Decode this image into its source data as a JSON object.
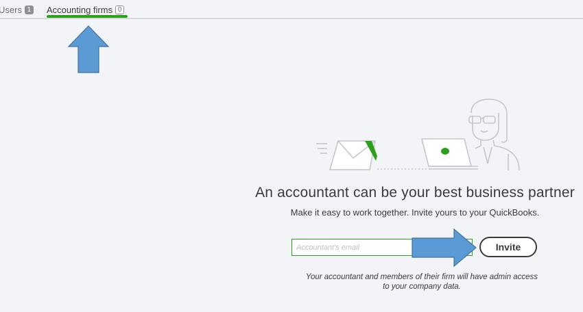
{
  "tabs": [
    {
      "label": "Users",
      "count": "1"
    },
    {
      "label": "Accounting firms",
      "count": "0"
    }
  ],
  "empty_state": {
    "headline": "An accountant can be your best business partner",
    "subline": "Make it easy to work together. Invite yours to your QuickBooks.",
    "email_placeholder": "Accountant's email",
    "email_value": "",
    "invite_label": "Invite",
    "note": "Your accountant and members of their firm will have admin access to your company data."
  },
  "colors": {
    "accent_green": "#2ca01c",
    "annotation_blue": "#5b9bd5",
    "text": "#393a3d",
    "background": "#f3f4f8"
  },
  "icons": {
    "envelope": "envelope-icon",
    "laptop": "laptop-icon",
    "person": "accountant-person-icon",
    "annotation_up": "arrow-up-icon",
    "annotation_right": "arrow-right-icon"
  }
}
